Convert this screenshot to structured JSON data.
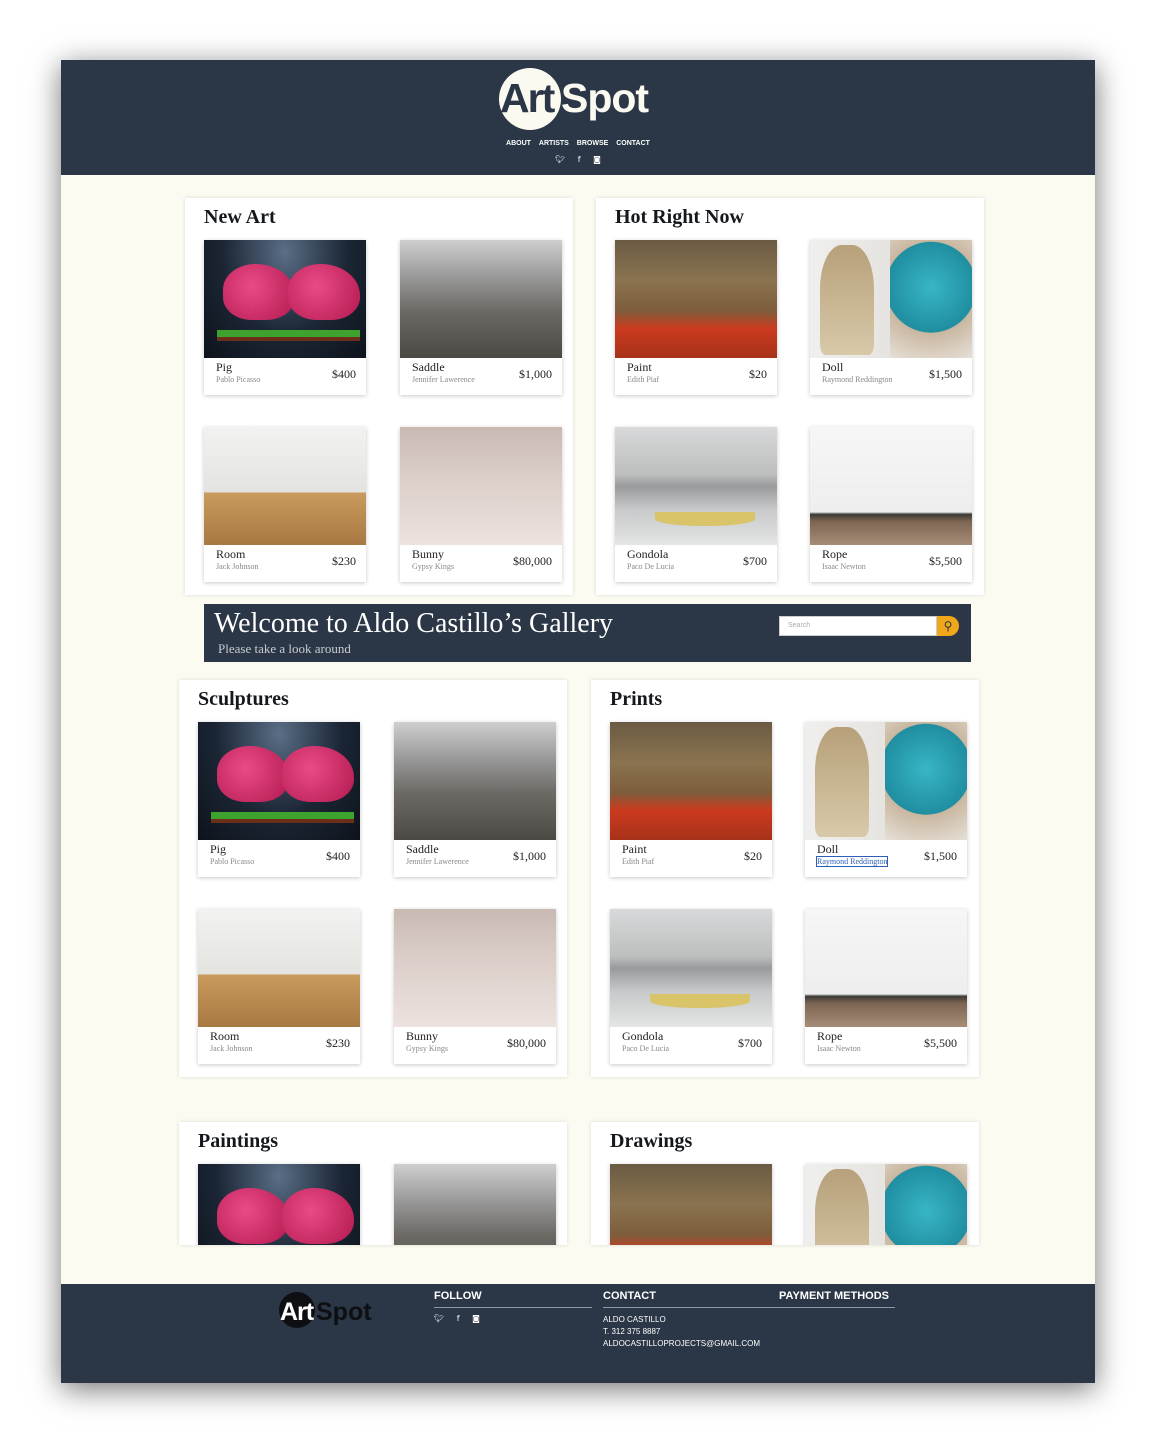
{
  "header": {
    "logo_art": "Art",
    "logo_spot": "Spot",
    "nav": [
      "ABOUT",
      "ARTISTS",
      "BROWSE",
      "CONTACT"
    ],
    "social_icons": [
      "twitter-icon",
      "facebook-icon",
      "instagram-icon"
    ]
  },
  "sections": {
    "new_art": {
      "title": "New Art",
      "items": [
        {
          "title": "Pig",
          "artist": "Pablo Picasso",
          "price": "$400"
        },
        {
          "title": "Saddle",
          "artist": "Jennifer Lawerence",
          "price": "$1,000"
        },
        {
          "title": "Room",
          "artist": "Jack Johnson",
          "price": "$230"
        },
        {
          "title": "Bunny",
          "artist": "Gypsy Kings",
          "price": "$80,000"
        }
      ]
    },
    "hot": {
      "title": "Hot Right Now",
      "items": [
        {
          "title": "Paint",
          "artist": "Edith Piaf",
          "price": "$20"
        },
        {
          "title": "Doll",
          "artist": "Raymond Reddington",
          "price": "$1,500"
        },
        {
          "title": "Gondola",
          "artist": "Paco De Lucia",
          "price": "$700"
        },
        {
          "title": "Rope",
          "artist": "Isaac Newton",
          "price": "$5,500"
        }
      ]
    },
    "sculptures": {
      "title": "Sculptures",
      "items": [
        {
          "title": "Pig",
          "artist": "Pablo Picasso",
          "price": "$400"
        },
        {
          "title": "Saddle",
          "artist": "Jennifer Lawerence",
          "price": "$1,000"
        },
        {
          "title": "Room",
          "artist": "Jack Johnson",
          "price": "$230"
        },
        {
          "title": "Bunny",
          "artist": "Gypsy Kings",
          "price": "$80,000"
        }
      ]
    },
    "prints": {
      "title": "Prints",
      "items": [
        {
          "title": "Paint",
          "artist": "Edith Piaf",
          "price": "$20"
        },
        {
          "title": "Doll",
          "artist": "Raymond Reddington",
          "price": "$1,500"
        },
        {
          "title": "Gondola",
          "artist": "Paco De Lucia",
          "price": "$700"
        },
        {
          "title": "Rope",
          "artist": "Isaac Newton",
          "price": "$5,500"
        }
      ]
    },
    "paintings": {
      "title": "Paintings"
    },
    "drawings": {
      "title": "Drawings"
    }
  },
  "welcome": {
    "title": "Welcome to Aldo Castillo’s Gallery",
    "subtitle": "Please take a look around",
    "search_placeholder": "Search"
  },
  "footer": {
    "logo_art": "Art",
    "logo_spot": "Spot",
    "follow_label": "FOLLOW",
    "contact_label": "CONTACT",
    "payment_label": "PAYMENT METHODS",
    "contact_name": "ALDO CASTILLO",
    "contact_phone": "T. 312 375 8887",
    "contact_email": "ALDOCASTILLOPROJECTS@GMAIL.COM"
  },
  "colors": {
    "navy": "#2b3746",
    "cream": "#fbfbf1",
    "accent": "#f0a81a"
  }
}
